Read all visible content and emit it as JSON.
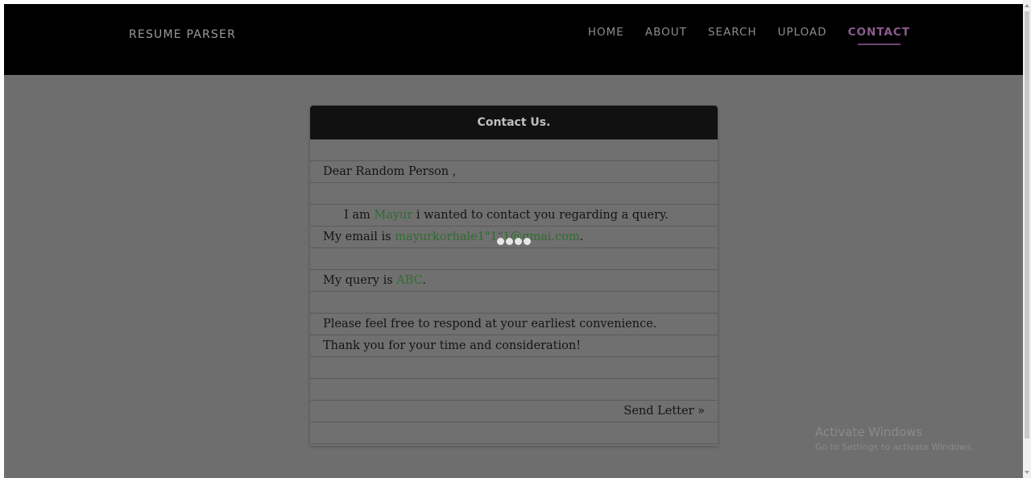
{
  "navbar": {
    "brand": "RESUME PARSER",
    "items": [
      {
        "label": "HOME"
      },
      {
        "label": "ABOUT"
      },
      {
        "label": "SEARCH"
      },
      {
        "label": "UPLOAD"
      },
      {
        "label": "CONTACT",
        "active": true
      }
    ]
  },
  "card": {
    "title": "Contact Us.",
    "salutation": "Dear Random Person ,",
    "intro_prefix": "I am",
    "name": "Mayur",
    "intro_suffix": "i wanted to contact you regarding a query.",
    "email_prefix": "My email is",
    "email": "mayurkorhale1\"1\"1@gmai.com",
    "email_suffix": ".",
    "query_prefix": "My query is",
    "query": "ABC",
    "query_suffix": ".",
    "closing1": "Please feel free to respond at your earliest convenience.",
    "closing2": "Thank you for your time and consideration!",
    "send_label": "Send Letter »"
  },
  "watermark": {
    "title": "Activate Windows",
    "subtitle": "Go to Settings to activate Windows."
  },
  "colors": {
    "navbar_bg": "#000000",
    "overlay": "#6e6e6e",
    "highlight": "#2f6e2f",
    "nav_active": "#8a5c8e"
  }
}
